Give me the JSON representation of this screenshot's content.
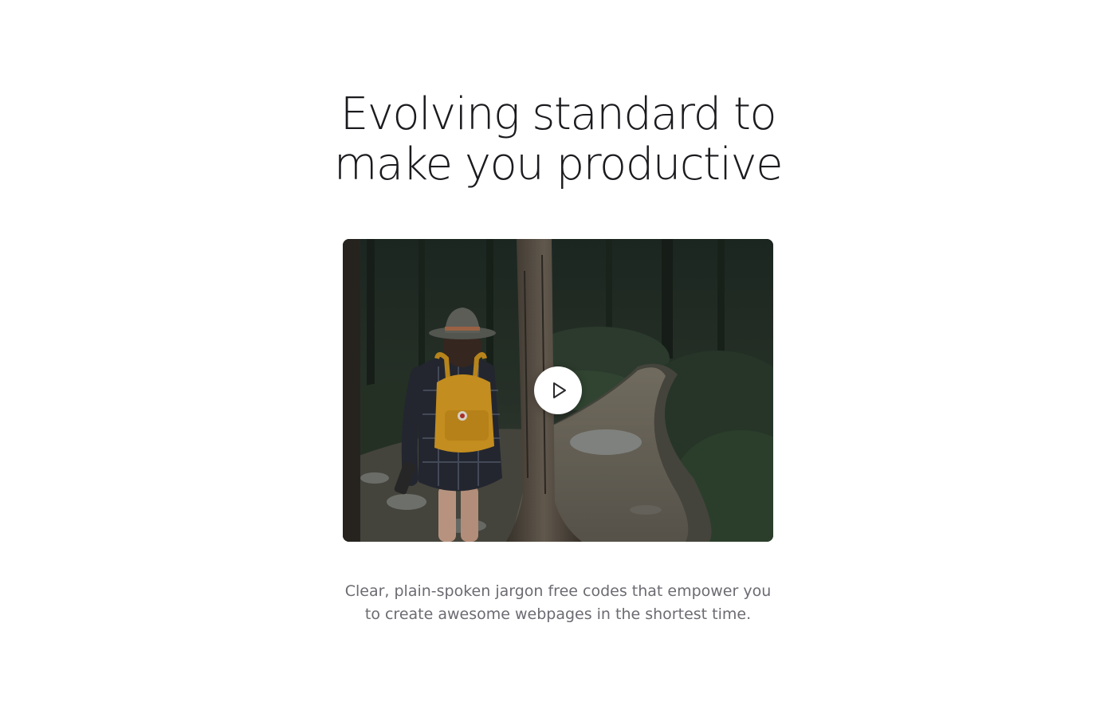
{
  "hero": {
    "title_lines": [
      "Evolving standard to",
      "make you productive"
    ],
    "video": {
      "play_icon": "play-icon"
    },
    "description_lines": [
      "Clear, plain-spoken jargon free codes that empower you",
      "to create awesome webpages in the shortest time."
    ]
  },
  "colors": {
    "background": "#ffffff",
    "title": "#1b1b1f",
    "body_text": "#6b6b72",
    "play_button": "#ffffff"
  }
}
